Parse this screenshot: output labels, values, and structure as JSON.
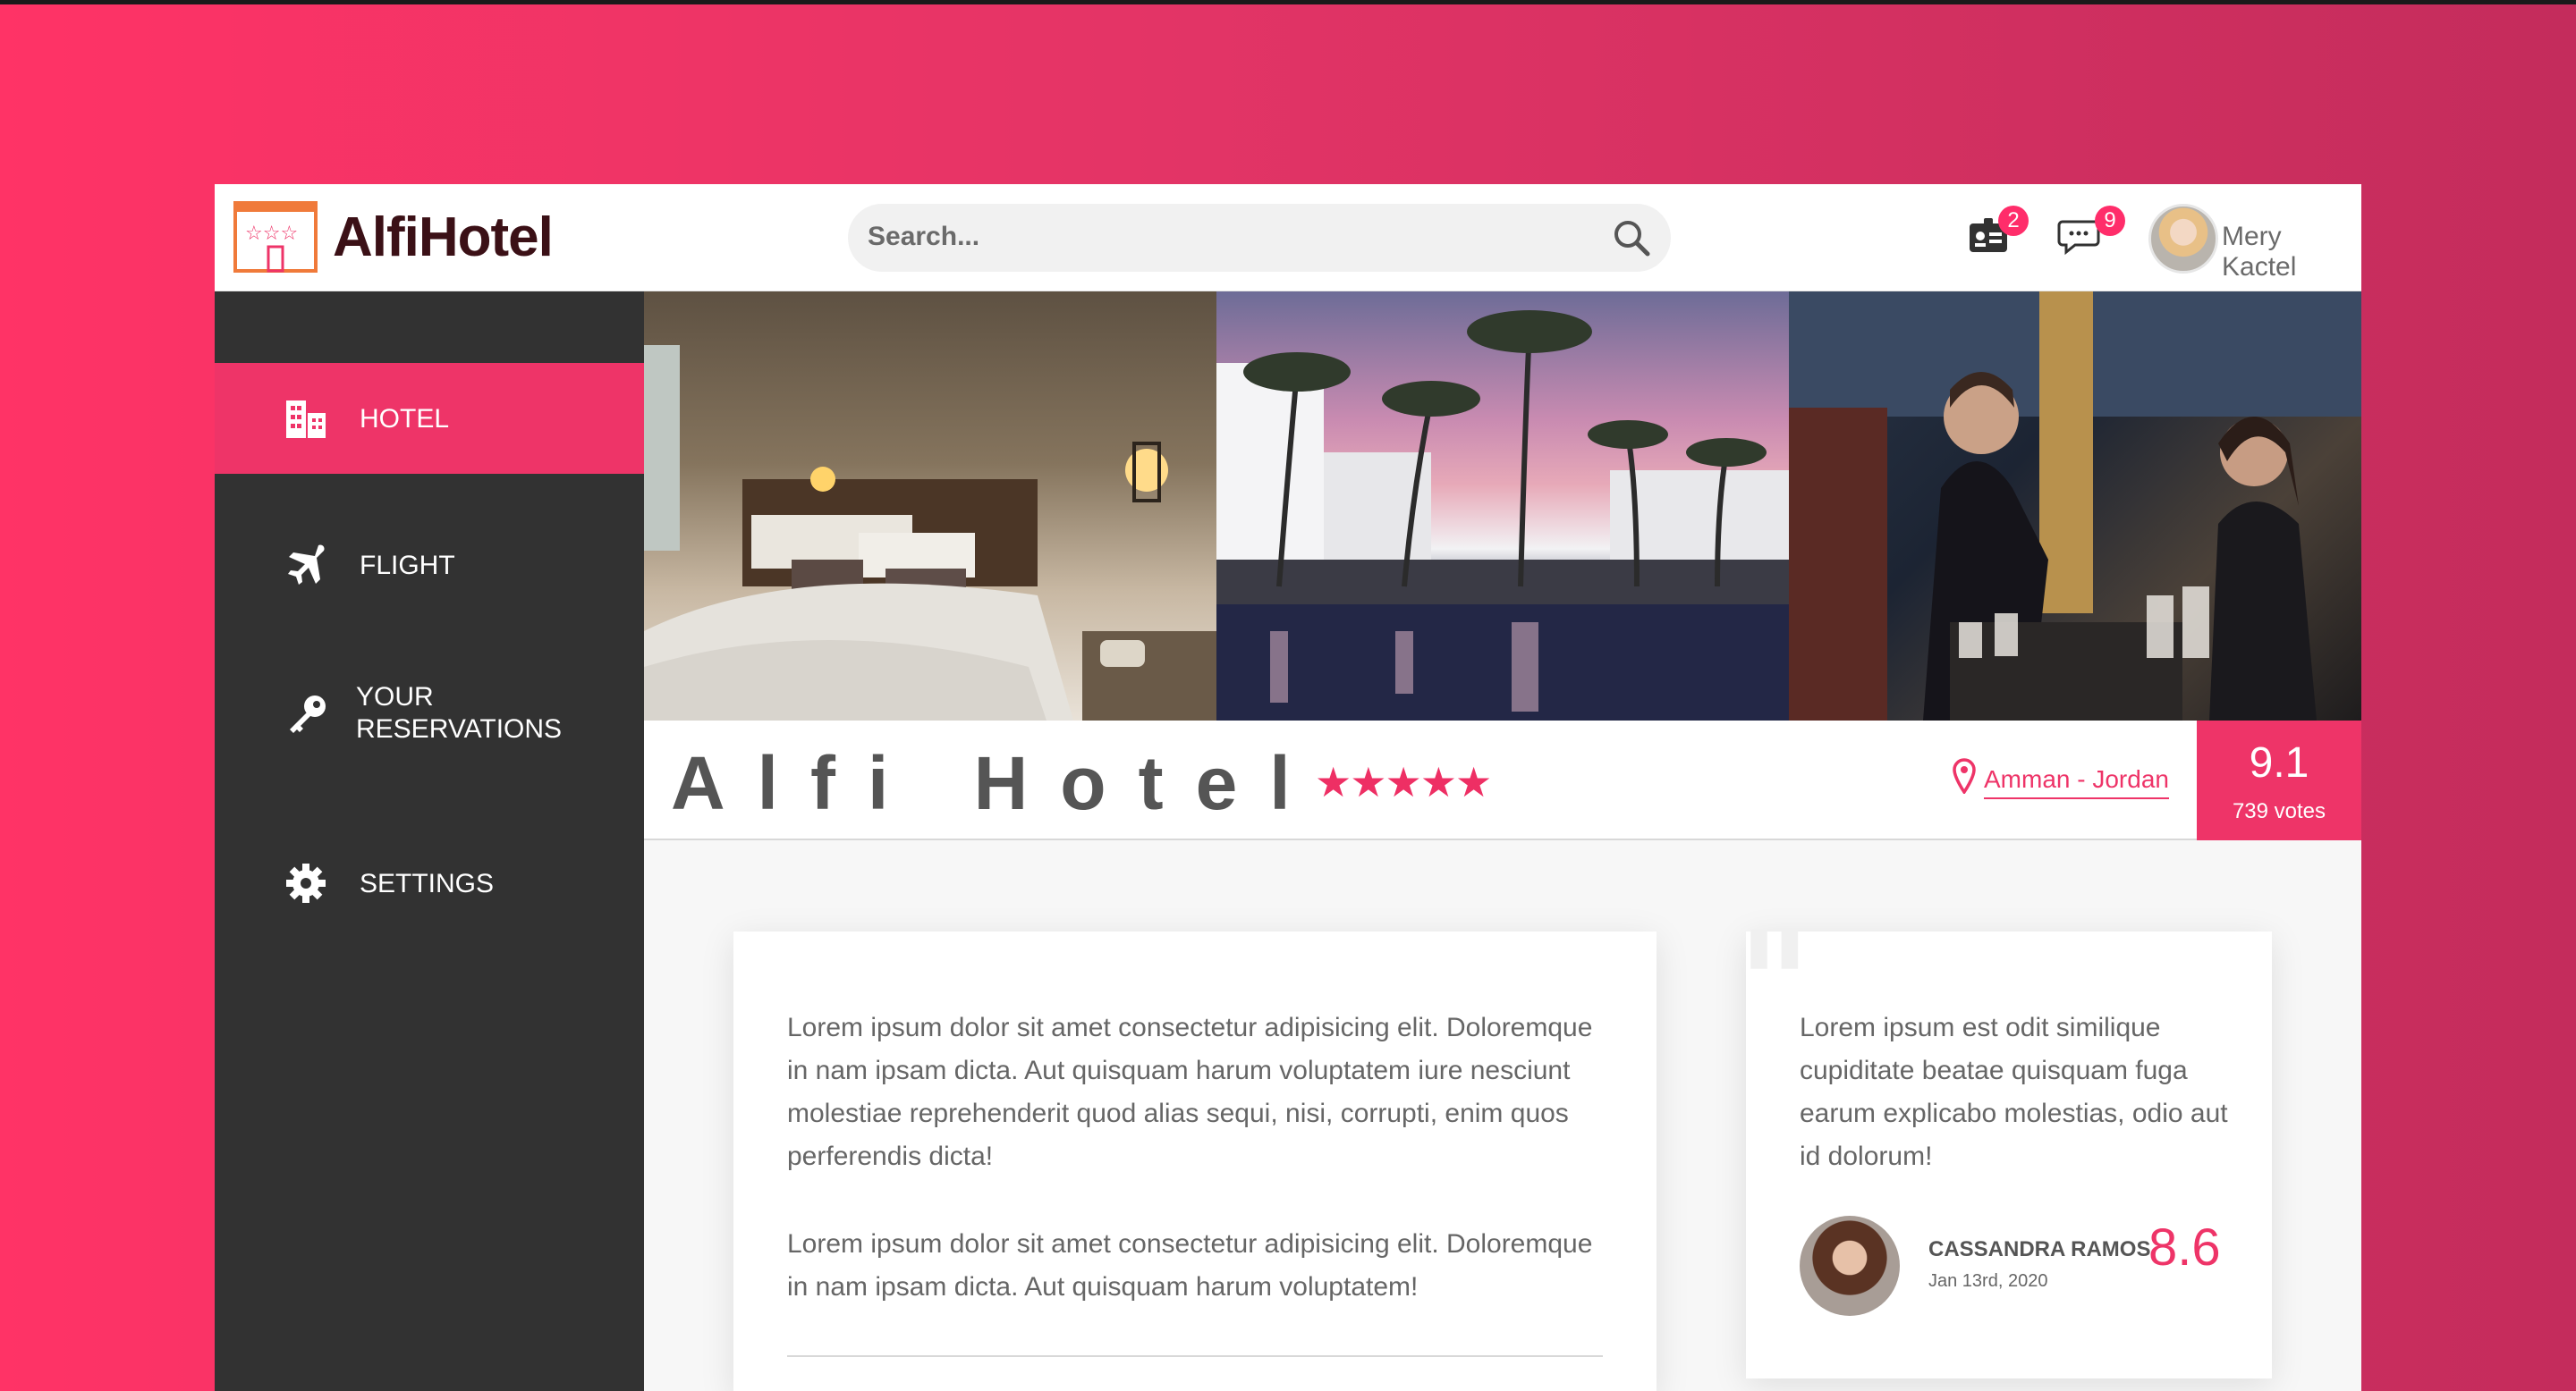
{
  "app": {
    "brand": "AlfiHotel",
    "search_placeholder": "Search...",
    "notifications": {
      "tickets_count": "2",
      "messages_count": "9"
    },
    "user": {
      "name": "Mery Kactel"
    }
  },
  "sidebar": {
    "items": [
      {
        "label": "HOTEL",
        "icon": "building-icon",
        "active": true
      },
      {
        "label": "FLIGHT",
        "icon": "plane-icon",
        "active": false
      },
      {
        "label": "YOUR RESERVATIONS",
        "icon": "key-icon",
        "active": false
      },
      {
        "label": "SETTINGS",
        "icon": "gear-icon",
        "active": false
      }
    ]
  },
  "hotel": {
    "name": "Alfi Hotel",
    "stars": "★★★★★",
    "location": "Amman - Jordan",
    "score": "9.1",
    "votes": "739 votes"
  },
  "description": {
    "paragraph1": "Lorem ipsum dolor sit amet consectetur adipisicing elit. Doloremque in nam ipsam dicta. Aut quisquam harum voluptatem iure nesciunt molestiae reprehenderit quod alias sequi, nisi, corrupti, enim quos perferendis dicta!",
    "paragraph2": "Lorem ipsum dolor sit amet consectetur adipisicing elit. Doloremque in nam ipsam dicta. Aut quisquam harum voluptatem!"
  },
  "review": {
    "quote_mark": "\"",
    "text": "Lorem ipsum est odit similique cupiditate beatae quisquam fuga earum explicabo molestias, odio aut id dolorum!",
    "author": "CASSANDRA RAMOS",
    "date": "Jan 13rd, 2020",
    "score": "8.6"
  },
  "colors": {
    "accent": "#ee3468",
    "sidebar": "#323232",
    "background_gradient_start": "#ff3366",
    "background_gradient_end": "#c42c5c"
  }
}
